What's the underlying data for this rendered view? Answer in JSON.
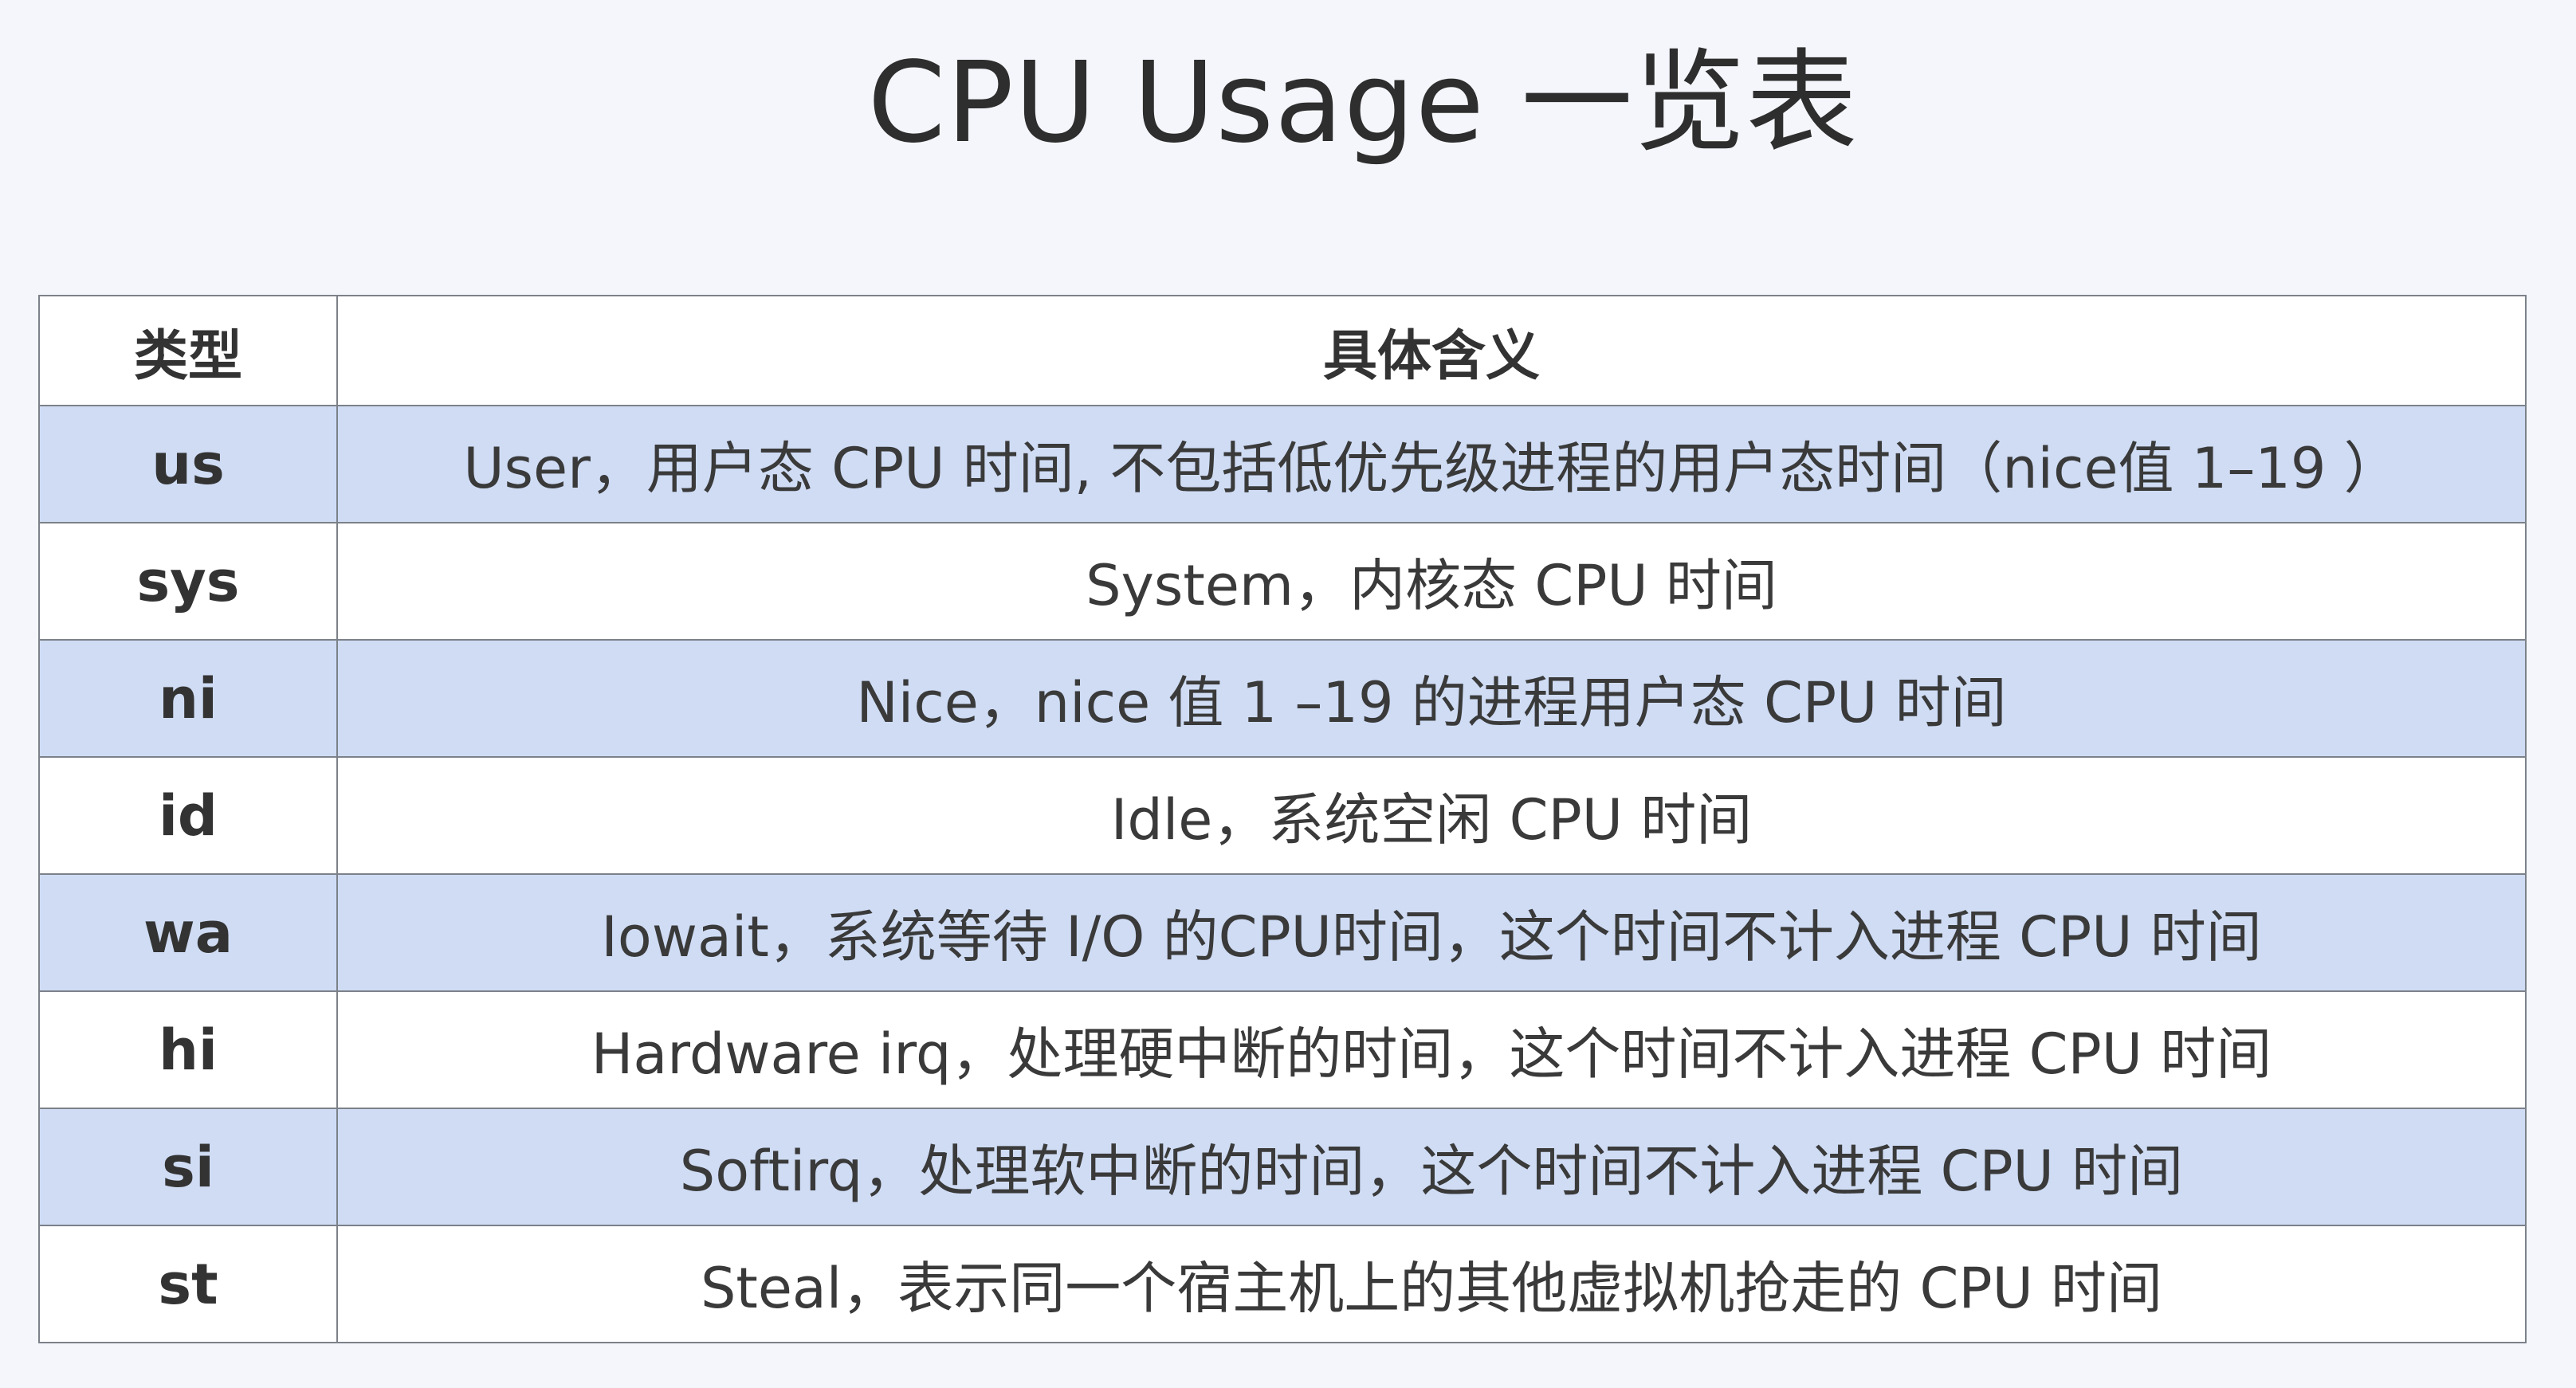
{
  "title": "CPU Usage 一览表",
  "table": {
    "headers": {
      "type": "类型",
      "meaning": "具体含义"
    },
    "rows": [
      {
        "type": "us",
        "meaning": "User，用户态 CPU 时间, 不包括低优先级进程的用户态时间（nice值 1–19 ）"
      },
      {
        "type": "sys",
        "meaning": "System，内核态 CPU 时间"
      },
      {
        "type": "ni",
        "meaning": "Nice，nice 值 1 –19 的进程用户态 CPU 时间"
      },
      {
        "type": "id",
        "meaning": "Idle，系统空闲 CPU 时间"
      },
      {
        "type": "wa",
        "meaning": "Iowait，系统等待 I/O 的CPU时间，这个时间不计入进程 CPU 时间"
      },
      {
        "type": "hi",
        "meaning": "Hardware irq，处理硬中断的时间，这个时间不计入进程 CPU 时间"
      },
      {
        "type": "si",
        "meaning": "Softirq，处理软中断的时间，这个时间不计入进程 CPU 时间"
      },
      {
        "type": "st",
        "meaning": "Steal，表示同一个宿主机上的其他虚拟机抢走的 CPU 时间"
      }
    ]
  },
  "colors": {
    "background": "#f4f6fb",
    "row_highlight": "#cfdcf4",
    "row_plain": "#ffffff",
    "border": "#7c8189"
  }
}
